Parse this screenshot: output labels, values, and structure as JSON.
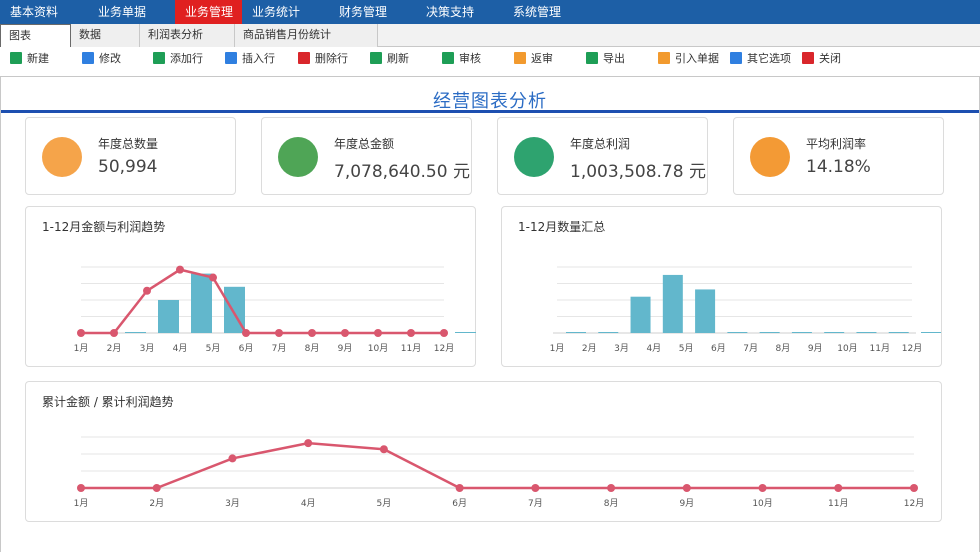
{
  "menu": {
    "items": [
      {
        "label": "基本资料",
        "active": false
      },
      {
        "label": "业务单据",
        "active": false
      },
      {
        "label": "业务管理",
        "active": true
      },
      {
        "label": "业务统计",
        "active": false
      },
      {
        "label": "财务管理",
        "active": false
      },
      {
        "label": "决策支持",
        "active": false
      },
      {
        "label": "系统管理",
        "active": false
      }
    ]
  },
  "tabs": [
    {
      "label": "图表",
      "active": true
    },
    {
      "label": "数据",
      "active": false
    },
    {
      "label": "利润表分析",
      "active": false
    },
    {
      "label": "商品销售月份统计",
      "active": false
    }
  ],
  "toolbar": [
    {
      "label": "新建",
      "color": "#1e9e56"
    },
    {
      "label": "修改",
      "color": "#2f7fe0"
    },
    {
      "label": "添加行",
      "color": "#1e9e56"
    },
    {
      "label": "插入行",
      "color": "#2f7fe0"
    },
    {
      "label": "删除行",
      "color": "#d9262b"
    },
    {
      "label": "刷新",
      "color": "#1e9e56"
    },
    {
      "label": "审核",
      "color": "#1e9e56"
    },
    {
      "label": "返审",
      "color": "#f29a2e"
    },
    {
      "label": "导出",
      "color": "#1e9e56"
    },
    {
      "label": "引入单据",
      "color": "#f29a2e"
    },
    {
      "label": "其它选项",
      "color": "#2f7fe0"
    },
    {
      "label": "关闭",
      "color": "#d9262b"
    }
  ],
  "page": {
    "title": "经营图表分析"
  },
  "stats": [
    {
      "label": "年度总数量",
      "value": "50,994",
      "color": "#f5a44a"
    },
    {
      "label": "年度总金额",
      "value": "7,078,640.50 元",
      "color": "#4fa556"
    },
    {
      "label": "年度总利润",
      "value": "1,003,508.78 元",
      "color": "#2ea36f"
    },
    {
      "label": "平均利润率",
      "value": "14.18%",
      "color": "#f39a35"
    }
  ],
  "chart_data": [
    {
      "type": "bar",
      "title": "1-12月金额与利润趋势",
      "categories": [
        "1月",
        "2月",
        "3月",
        "4月",
        "5月",
        "6月",
        "7月",
        "8月",
        "9月",
        "10月",
        "11月",
        "12月"
      ],
      "series": [
        {
          "values": [
            0,
            0,
            0.5,
            0.9,
            0.7,
            0,
            0,
            0,
            0,
            0,
            0,
            0
          ],
          "color": "#62b7cc",
          "kind": "bar"
        },
        {
          "values": [
            0,
            0,
            0.64,
            0.96,
            0.84,
            0,
            0,
            0,
            0,
            0,
            0,
            0
          ],
          "color": "#d9576e",
          "kind": "line"
        }
      ],
      "ylim": [
        0,
        1
      ],
      "grid": true
    },
    {
      "type": "bar",
      "title": "1-12月数量汇总",
      "categories": [
        "1月",
        "2月",
        "3月",
        "4月",
        "5月",
        "6月",
        "7月",
        "8月",
        "9月",
        "10月",
        "11月",
        "12月"
      ],
      "series": [
        {
          "values": [
            0,
            0,
            0.55,
            0.88,
            0.66,
            0,
            0,
            0,
            0,
            0,
            0,
            0
          ],
          "color": "#62b7cc",
          "kind": "bar"
        }
      ],
      "ylim": [
        0,
        1
      ],
      "grid": true
    },
    {
      "type": "line",
      "title": "累计金额 / 累计利润趋势",
      "categories": [
        "1月",
        "2月",
        "3月",
        "4月",
        "5月",
        "6月",
        "7月",
        "8月",
        "9月",
        "10月",
        "11月",
        "12月"
      ],
      "series": [
        {
          "values": [
            0,
            0,
            0.58,
            0.88,
            0.76,
            0,
            0,
            0,
            0,
            0,
            0,
            0
          ],
          "color": "#d9576e",
          "kind": "line"
        }
      ],
      "ylim": [
        0,
        1
      ],
      "grid": true
    }
  ]
}
